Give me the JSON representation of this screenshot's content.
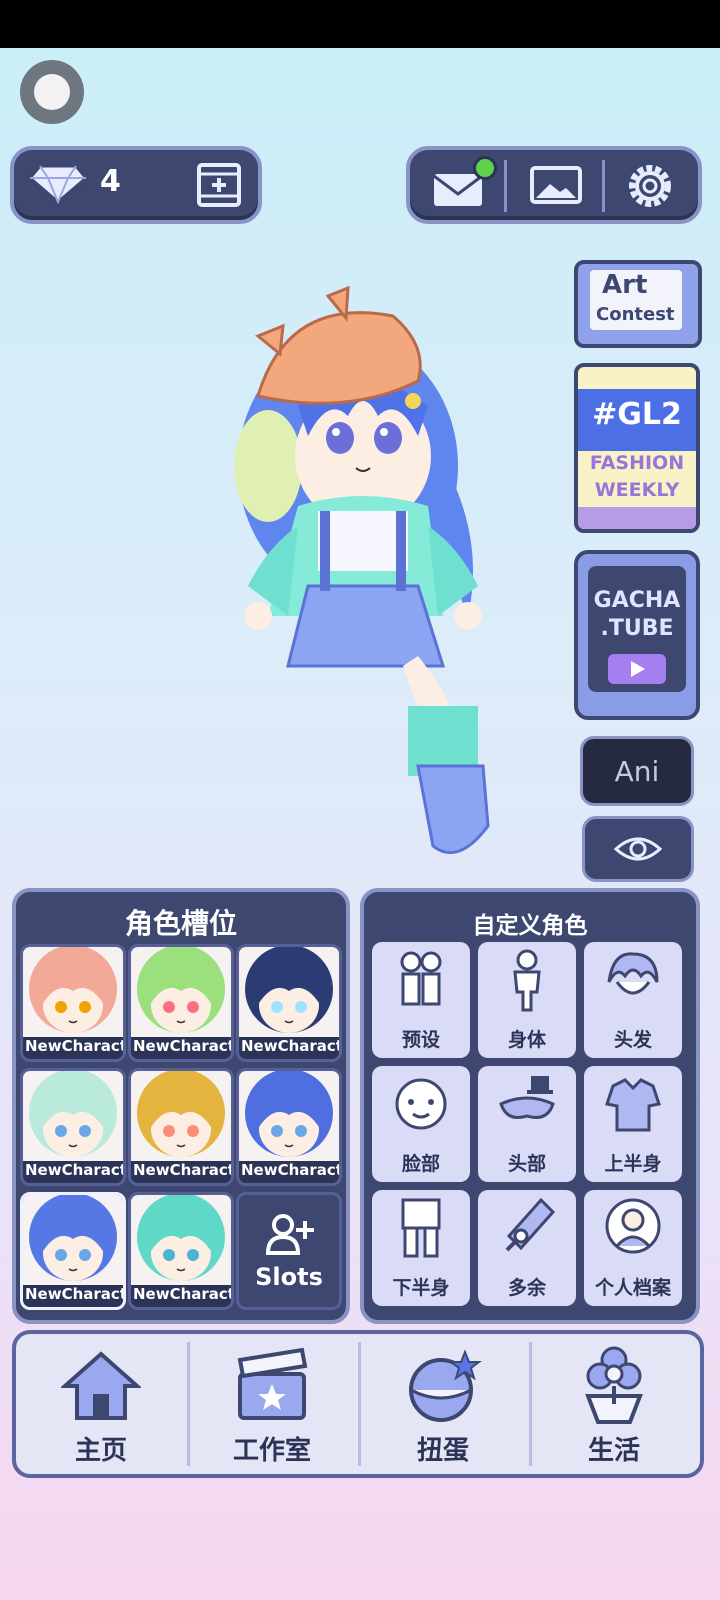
{
  "top_bar": {
    "gem_count": "4"
  },
  "side_buttons": {
    "art_contest": {
      "line1": "Art",
      "line2": "Contest"
    },
    "fashion_weekly": {
      "tag": "#GL2",
      "line1": "FASHION",
      "line2": "WEEKLY"
    },
    "gacha_tube": {
      "line1": "GACHA",
      "line2": ".TUBE"
    },
    "ani_label": "Ani"
  },
  "slots_panel": {
    "title": "角色槽位",
    "slots": [
      {
        "name": "NewCharacter",
        "hair": "#f2a998",
        "eyes": "#f0a400"
      },
      {
        "name": "NewCharacter",
        "hair": "#9be07d",
        "eyes": "#ff6f7f"
      },
      {
        "name": "NewCharacter",
        "hair": "#2b3c74",
        "eyes": "#9fe4ff"
      },
      {
        "name": "NewCharacter",
        "hair": "#b9eadb",
        "eyes": "#6aa7e8"
      },
      {
        "name": "NewCharacter",
        "hair": "#e4b43f",
        "eyes": "#ff8b7b"
      },
      {
        "name": "NewCharacter",
        "hair": "#4f6fe0",
        "eyes": "#6aa7e8"
      },
      {
        "name": "NewCharacter",
        "hair": "#5578e5",
        "eyes": "#6aa7e8"
      },
      {
        "name": "NewCharacter",
        "hair": "#5fd8c8",
        "eyes": "#4bb3d4"
      }
    ],
    "add_label": "Slots"
  },
  "custom_panel": {
    "title": "自定义角色",
    "categories": [
      "预设",
      "身体",
      "头发",
      "脸部",
      "头部",
      "上半身",
      "下半身",
      "多余",
      "个人档案"
    ]
  },
  "bottom_nav": [
    "主页",
    "工作室",
    "扭蛋",
    "生活"
  ]
}
